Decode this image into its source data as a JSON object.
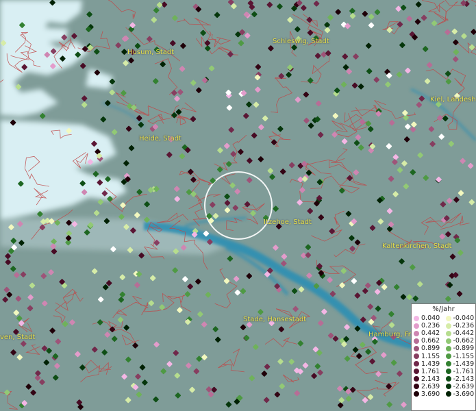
{
  "map": {
    "colors": {
      "land": "#7f9c98",
      "water": "#d9eff3",
      "river": "#2f8fb3",
      "border": "#c04848",
      "label": "#e8e24a",
      "search_circle": "#ffffff"
    },
    "cities": [
      {
        "name": "Husum, Stadt"
      },
      {
        "name": "Schleswig, Stadt"
      },
      {
        "name": "Kiel, Landesh"
      },
      {
        "name": "Heide, Stadt"
      },
      {
        "name": "Itzehoe, Stadt"
      },
      {
        "name": "Kaltenkirchen, Stadt"
      },
      {
        "name": "Stade, Hansestadt"
      },
      {
        "name": "Hamburg, Fr"
      },
      {
        "name": "ven, Stadt"
      }
    ]
  },
  "legend": {
    "title": "%/Jahr",
    "positive": [
      {
        "label": "0.040",
        "color": "#f3b6e4"
      },
      {
        "label": "0.236",
        "color": "#e39ccb"
      },
      {
        "label": "0.442",
        "color": "#cf86b2"
      },
      {
        "label": "0.662",
        "color": "#b76d96"
      },
      {
        "label": "0.899",
        "color": "#9e5479"
      },
      {
        "label": "1.155",
        "color": "#873e60"
      },
      {
        "label": "1.439",
        "color": "#70284a"
      },
      {
        "label": "1.761",
        "color": "#5a1634"
      },
      {
        "label": "2.143",
        "color": "#470b24"
      },
      {
        "label": "2.639",
        "color": "#330414"
      },
      {
        "label": "3.690",
        "color": "#1e0008"
      }
    ],
    "negative": [
      {
        "label": "-0.040",
        "color": "#f2f8bf"
      },
      {
        "label": "-0.236",
        "color": "#d6eca8"
      },
      {
        "label": "-0.442",
        "color": "#b6dd8e"
      },
      {
        "label": "-0.662",
        "color": "#92c975"
      },
      {
        "label": "-0.899",
        "color": "#6fb25a"
      },
      {
        "label": "-1.155",
        "color": "#4f9a44"
      },
      {
        "label": "-1.439",
        "color": "#338131"
      },
      {
        "label": "-1.761",
        "color": "#1d6621"
      },
      {
        "label": "-2.143",
        "color": "#0e4e15"
      },
      {
        "label": "-2.639",
        "color": "#05360b"
      },
      {
        "label": "-3.690",
        "color": "#002104"
      }
    ]
  }
}
